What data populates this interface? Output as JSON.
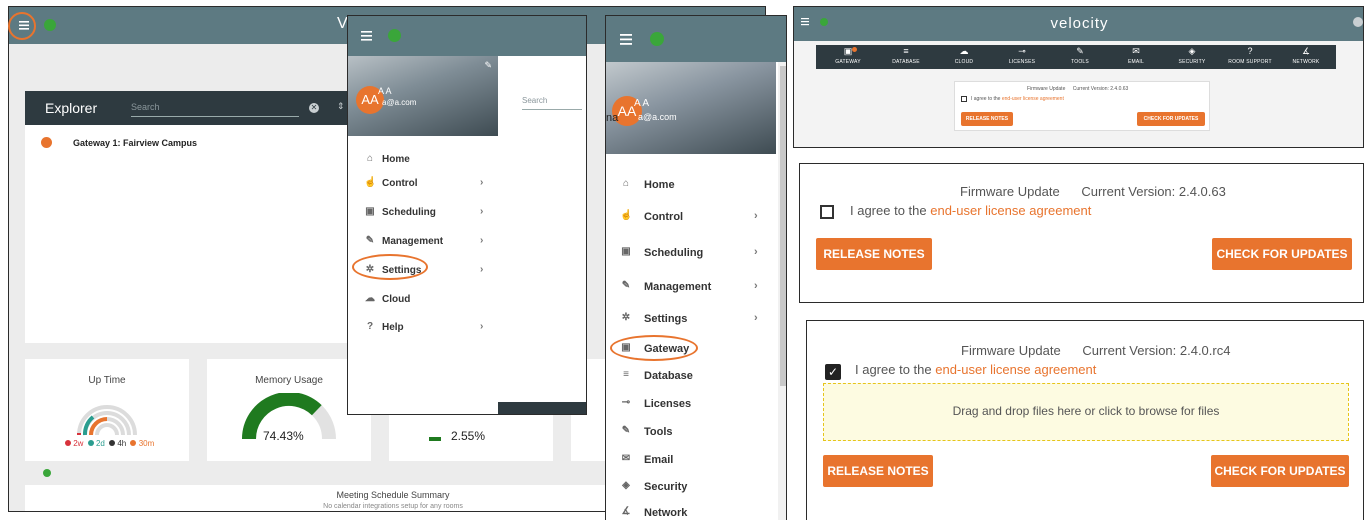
{
  "panel1": {
    "explorer_title": "Explorer",
    "search_placeholder": "Search",
    "gateway_item": "Gateway 1: Fairview Campus",
    "uptime_title": "Up Time",
    "uptime_legend": [
      {
        "label": "2w",
        "color": "#d8323b"
      },
      {
        "label": "2d",
        "color": "#2a9d8f"
      },
      {
        "label": "4h",
        "color": "#333333"
      },
      {
        "label": "30m",
        "color": "#e8742e"
      }
    ],
    "memory_title": "Memory Usage",
    "memory_value": "74.43%",
    "memory_fraction": 0.7443,
    "cpu_value": "2.55%",
    "meeting_title": "Meeting Schedule Summary",
    "meeting_subtitle": "No calendar integrations setup for any rooms"
  },
  "panel2": {
    "avatar": "AA",
    "user_name": "A A",
    "user_email": "a@a.com",
    "search_placeholder": "Search",
    "menu": [
      {
        "label": "Home",
        "icon": "home-icon",
        "chevron": false
      },
      {
        "label": "Control",
        "icon": "touch-icon",
        "chevron": true
      },
      {
        "label": "Scheduling",
        "icon": "calendar-icon",
        "chevron": true
      },
      {
        "label": "Management",
        "icon": "wrench-icon",
        "chevron": true
      },
      {
        "label": "Settings",
        "icon": "gear-icon",
        "chevron": true
      },
      {
        "label": "Cloud",
        "icon": "cloud-icon",
        "chevron": false
      },
      {
        "label": "Help",
        "icon": "help-icon",
        "chevron": true
      }
    ]
  },
  "panel3": {
    "avatar": "AA",
    "user_name": "A A",
    "user_email": "a@a.com",
    "partial_name": "na",
    "menu": [
      {
        "label": "Home",
        "icon": "home-icon",
        "chevron": false
      },
      {
        "label": "Control",
        "icon": "touch-icon",
        "chevron": true
      },
      {
        "label": "Scheduling",
        "icon": "calendar-icon",
        "chevron": true
      },
      {
        "label": "Management",
        "icon": "wrench-icon",
        "chevron": true
      },
      {
        "label": "Settings",
        "icon": "gear-icon",
        "chevron": true
      },
      {
        "label": "Gateway",
        "icon": "gateway-icon",
        "chevron": false
      },
      {
        "label": "Database",
        "icon": "database-icon",
        "chevron": false
      },
      {
        "label": "Licenses",
        "icon": "key-icon",
        "chevron": false
      },
      {
        "label": "Tools",
        "icon": "wrench-icon",
        "chevron": false
      },
      {
        "label": "Email",
        "icon": "email-icon",
        "chevron": false
      },
      {
        "label": "Security",
        "icon": "shield-icon",
        "chevron": false
      },
      {
        "label": "Network",
        "icon": "network-icon",
        "chevron": false
      }
    ]
  },
  "panel4": {
    "brand": "velocity",
    "nav": [
      "GATEWAY",
      "DATABASE",
      "CLOUD",
      "LICENSES",
      "TOOLS",
      "EMAIL",
      "SECURITY",
      "ROOM SUPPORT",
      "NETWORK"
    ],
    "fw_title": "Firmware Update",
    "fw_version": "Current Version: 2.4.0.63",
    "agree_prefix": "I agree to the ",
    "agree_link": "end-user license agreement",
    "release_notes": "RELEASE NOTES",
    "check_updates": "CHECK FOR UPDATES"
  },
  "panel5": {
    "fw_title": "Firmware Update",
    "fw_version": "Current Version: 2.4.0.63",
    "agree_prefix": "I agree to the ",
    "agree_link": "end-user license agreement",
    "release_notes": "RELEASE NOTES",
    "check_updates": "CHECK FOR UPDATES"
  },
  "panel6": {
    "fw_title": "Firmware Update",
    "fw_version": "Current Version: 2.4.0.rc4",
    "agree_prefix": "I agree to the ",
    "agree_link": "end-user license agreement",
    "dropzone": "Drag and drop files here or click to browse for files",
    "release_notes": "RELEASE NOTES",
    "check_updates": "CHECK FOR UPDATES"
  },
  "colors": {
    "accent": "#e8742e",
    "topbar": "#5d7a82",
    "explorer_head": "#2e3a40",
    "green": "#1f8a1f"
  }
}
